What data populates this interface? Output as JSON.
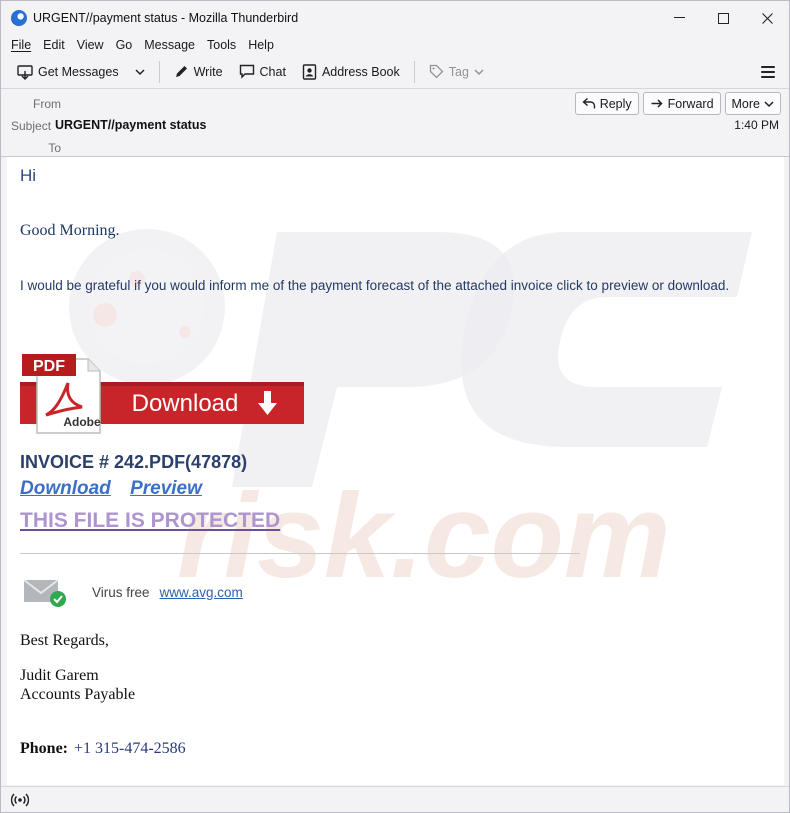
{
  "window": {
    "title": "URGENT//payment status - Mozilla Thunderbird"
  },
  "menu": {
    "items": [
      "File",
      "Edit",
      "View",
      "Go",
      "Message",
      "Tools",
      "Help"
    ]
  },
  "toolbar": {
    "get_messages": "Get Messages",
    "write": "Write",
    "chat": "Chat",
    "address_book": "Address Book",
    "tag": "Tag"
  },
  "headers": {
    "from_label": "From",
    "subject_label": "Subject",
    "to_label": "To",
    "subject": "URGENT//payment status",
    "time": "1:40 PM",
    "reply": "Reply",
    "forward": "Forward",
    "more": "More"
  },
  "body": {
    "greeting": "Hi",
    "good_morning": "Good Morning.",
    "paragraph": "I would be grateful if you would inform me of the payment forecast of the attached invoice click to preview or download.",
    "pdf_badge": "PDF",
    "adobe_label": "Adobe",
    "download_banner": "Download",
    "invoice": "INVOICE # 242.PDF(47878)",
    "download_link": "Download",
    "preview_link": "Preview",
    "protected": "THIS FILE IS PROTECTED",
    "virus_free": "Virus free",
    "avg_link": "www.avg.com",
    "regards": "Best Regards,",
    "sig_name": "Judit Garem",
    "sig_role": "Accounts Payable",
    "phone_label": "Phone:",
    "phone_number": "+1 315-474-2586"
  },
  "colors": {
    "banner_red": "#c8252a",
    "link_blue": "#3d6fc6",
    "protected_purple": "#ae95cf"
  },
  "icons": [
    "thunderbird-icon",
    "get-messages-icon",
    "dropdown-arrow-icon",
    "pencil-icon",
    "chat-icon",
    "address-book-icon",
    "tag-icon",
    "menu-icon",
    "reply-icon",
    "forward-icon",
    "chevron-down-icon",
    "pdf-icon",
    "download-arrow-icon",
    "mail-check-icon",
    "wifi-status-icon"
  ]
}
